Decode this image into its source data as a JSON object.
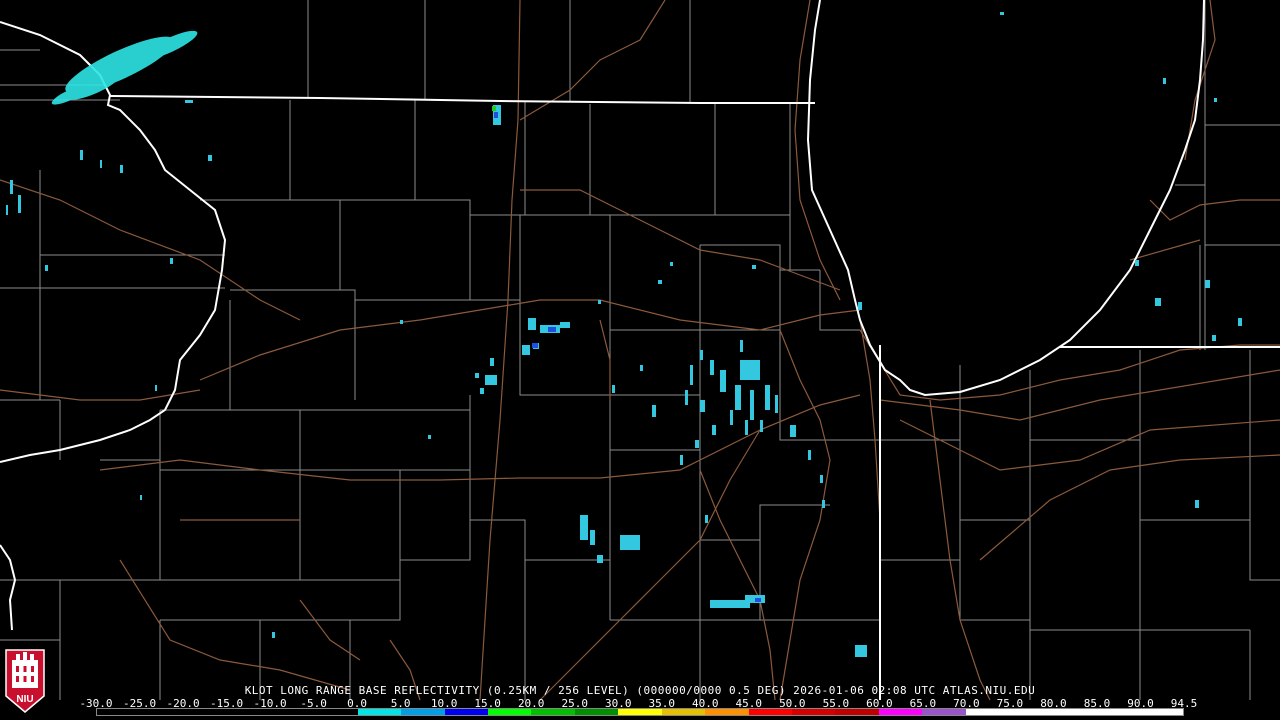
{
  "product": {
    "caption": "KLOT LONG RANGE BASE REFLECTIVITY (0.25KM / 256 LEVEL) (000000/0000 0.5 DEG) 2026-01-06 02:08 UTC  ATLAS.NIU.EDU"
  },
  "logo": {
    "text": "NIU",
    "color": "#c8102e"
  },
  "colorscale": {
    "labels": [
      "-30.0",
      "-25.0",
      "-20.0",
      "-15.0",
      "-10.0",
      "-5.0",
      "0.0",
      "5.0",
      "10.0",
      "15.0",
      "20.0",
      "25.0",
      "30.0",
      "35.0",
      "40.0",
      "45.0",
      "50.0",
      "55.0",
      "60.0",
      "65.0",
      "70.0",
      "75.0",
      "80.0",
      "85.0",
      "90.0",
      "94.5"
    ],
    "colors": [
      "#000000",
      "#000000",
      "#000000",
      "#000000",
      "#000000",
      "#000000",
      "#00e5e5",
      "#00a0e8",
      "#0000f0",
      "#00ff00",
      "#00c000",
      "#009000",
      "#ffff00",
      "#e7c000",
      "#ff9000",
      "#ff0000",
      "#d60000",
      "#c00000",
      "#ff00ff",
      "#9955c9",
      "#ffffff",
      "#ffffff",
      "#ffffff",
      "#ffffff",
      "#ffffff"
    ]
  },
  "map": {
    "colors": {
      "background": "#000000",
      "state_border": "#ffffff",
      "county_border": "#909090",
      "highway": "#8b5a3c",
      "echo_light": "#33c8e0",
      "echo_cyan": "#2ee6e6",
      "echo_blue": "#1f4fe0",
      "echo_green": "#22cc22"
    }
  }
}
